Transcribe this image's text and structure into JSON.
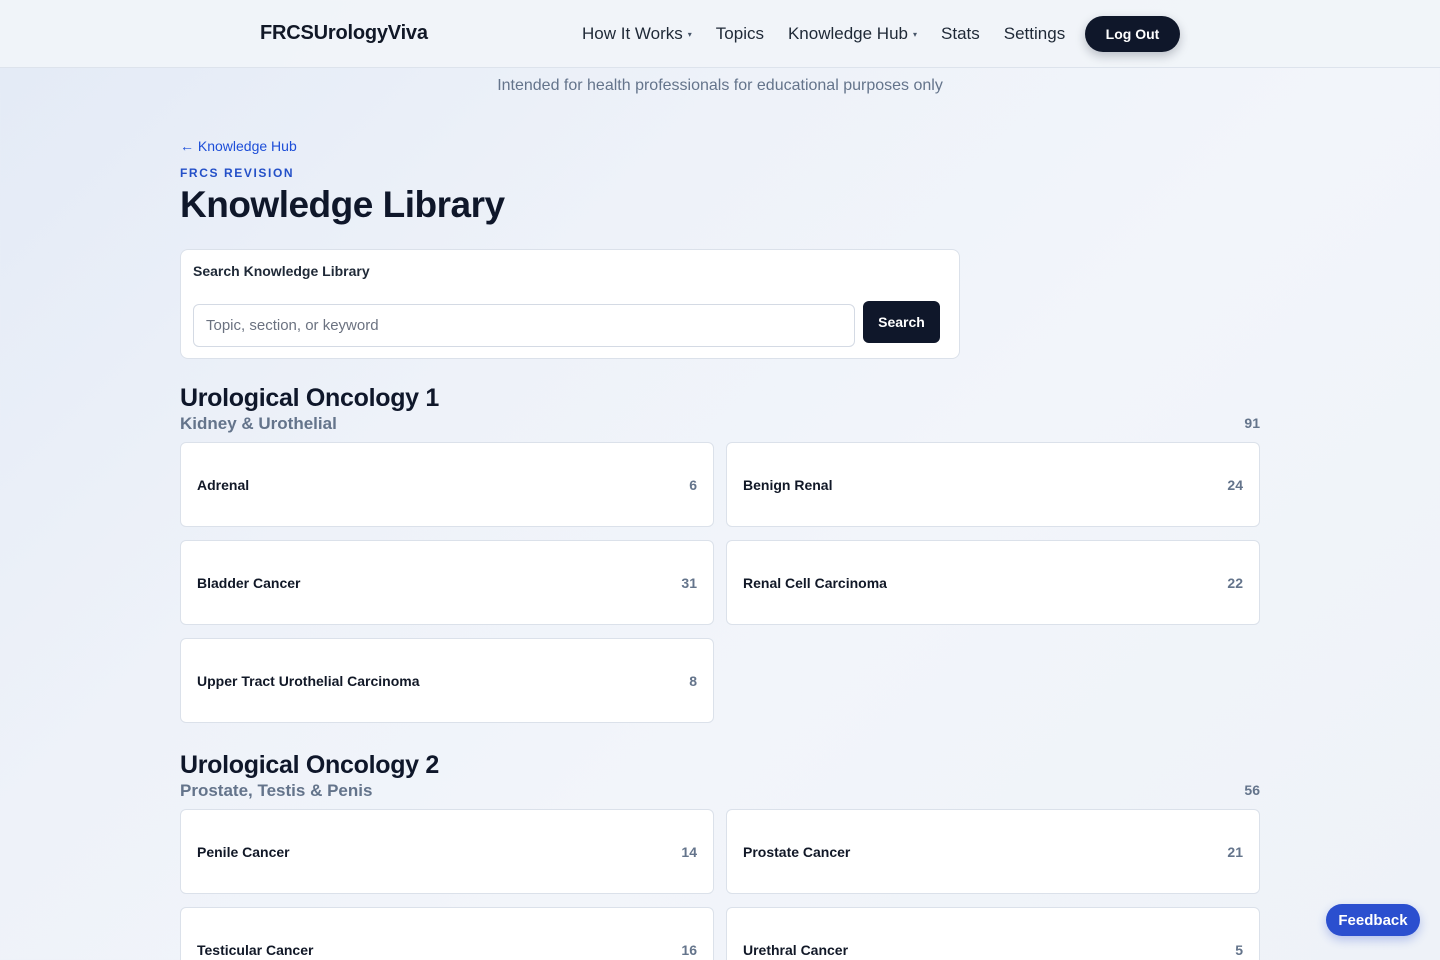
{
  "header": {
    "brand": "FRCSUrologyViva",
    "nav": [
      {
        "label": "How It Works",
        "caret": "▾"
      },
      {
        "label": "Topics",
        "caret": ""
      },
      {
        "label": "Knowledge Hub",
        "caret": "▾"
      },
      {
        "label": "Stats",
        "caret": ""
      },
      {
        "label": "Settings",
        "caret": ""
      }
    ],
    "logout_label": "Log Out"
  },
  "disclaimer": "Intended for health professionals for educational purposes only",
  "page": {
    "back_link": "← Knowledge Hub",
    "eyebrow": "FRCS REVISION",
    "title": "Knowledge Library"
  },
  "search": {
    "label": "Search Knowledge Library",
    "placeholder": "Topic, section, or keyword",
    "value": "",
    "button": "Search"
  },
  "sections": [
    {
      "title": "Urological Oncology 1",
      "subtitle": "Kidney & Urothelial",
      "count": "91",
      "topics": [
        {
          "name": "Adrenal",
          "count": "6"
        },
        {
          "name": "Benign Renal",
          "count": "24"
        },
        {
          "name": "Bladder Cancer",
          "count": "31"
        },
        {
          "name": "Renal Cell Carcinoma",
          "count": "22"
        },
        {
          "name": "Upper Tract Urothelial Carcinoma",
          "count": "8"
        }
      ]
    },
    {
      "title": "Urological Oncology 2",
      "subtitle": "Prostate, Testis & Penis",
      "count": "56",
      "topics": [
        {
          "name": "Penile Cancer",
          "count": "14"
        },
        {
          "name": "Prostate Cancer",
          "count": "21"
        },
        {
          "name": "Testicular Cancer",
          "count": "16"
        },
        {
          "name": "Urethral Cancer",
          "count": "5"
        }
      ]
    }
  ],
  "feedback_label": "Feedback"
}
